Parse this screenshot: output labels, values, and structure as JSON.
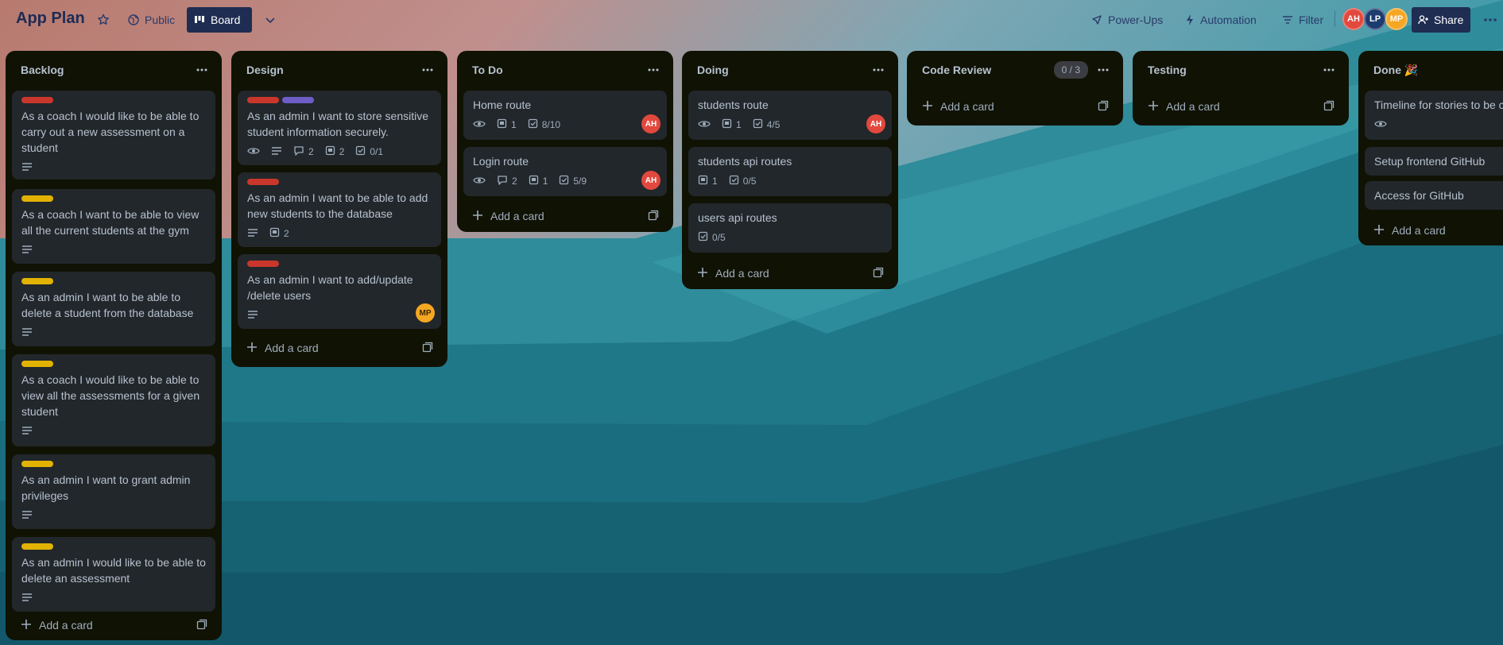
{
  "board": {
    "title": "App Plan",
    "visibility": "Public",
    "view": "Board"
  },
  "toolbar": {
    "power_ups": "Power-Ups",
    "automation": "Automation",
    "filter": "Filter",
    "share": "Share"
  },
  "members": [
    {
      "initials": "AH",
      "color": "#e2483d"
    },
    {
      "initials": "LP",
      "color": "#1d3b6e"
    },
    {
      "initials": "MP",
      "color": "#f5a623"
    }
  ],
  "add_card_label": "Add a card",
  "colors": {
    "red": "#c9372c",
    "yellow": "#e2b203",
    "purple": "#6e5dc6",
    "list_bg": "#101204",
    "card_bg": "#22272b"
  },
  "lists": [
    {
      "title": "Backlog",
      "cards": [
        {
          "labels": [
            "red"
          ],
          "title": "As a coach I would like to be able to carry out a new assessment on a student",
          "badges": [
            {
              "icon": "description-icon",
              "text": ""
            }
          ]
        },
        {
          "labels": [
            "yellow"
          ],
          "title": "As a coach I want to be able to view all the current students at the gym",
          "badges": [
            {
              "icon": "description-icon",
              "text": ""
            }
          ]
        },
        {
          "labels": [
            "yellow"
          ],
          "title": "As an admin I want to be able to delete a student from the database",
          "badges": [
            {
              "icon": "description-icon",
              "text": ""
            }
          ]
        },
        {
          "labels": [
            "yellow"
          ],
          "title": "As a coach I would like to be able to view all the assessments for a given student",
          "badges": [
            {
              "icon": "description-icon",
              "text": ""
            }
          ]
        },
        {
          "labels": [
            "yellow"
          ],
          "title": "As an admin I want to grant admin privileges",
          "badges": [
            {
              "icon": "description-icon",
              "text": ""
            }
          ]
        },
        {
          "labels": [
            "yellow"
          ],
          "title": "As an admin I would like to be able to delete an assessment",
          "badges": [
            {
              "icon": "description-icon",
              "text": ""
            }
          ]
        }
      ]
    },
    {
      "title": "Design",
      "cards": [
        {
          "labels": [
            "red",
            "purple"
          ],
          "title": "As an admin I want to store sensitive student information securely.",
          "badges": [
            {
              "icon": "eye-icon",
              "text": ""
            },
            {
              "icon": "description-icon",
              "text": ""
            },
            {
              "icon": "comment-icon",
              "text": "2"
            },
            {
              "icon": "attachment-icon",
              "text": "2"
            },
            {
              "icon": "checklist-icon",
              "text": "0/1"
            }
          ]
        },
        {
          "labels": [
            "red"
          ],
          "title": "As an admin I want to be able to add new students to the database",
          "badges": [
            {
              "icon": "description-icon",
              "text": ""
            },
            {
              "icon": "attachment-icon",
              "text": "2"
            }
          ]
        },
        {
          "labels": [
            "red"
          ],
          "title": "As an admin I want to add/update /delete users",
          "badges": [
            {
              "icon": "description-icon",
              "text": ""
            }
          ],
          "member": "MP"
        }
      ]
    },
    {
      "title": "To Do",
      "cards": [
        {
          "labels": [],
          "title": "Home route",
          "badges": [
            {
              "icon": "eye-icon",
              "text": ""
            },
            {
              "icon": "attachment-icon",
              "text": "1"
            },
            {
              "icon": "checklist-icon",
              "text": "8/10"
            }
          ],
          "member": "AH"
        },
        {
          "labels": [],
          "title": "Login route",
          "badges": [
            {
              "icon": "eye-icon",
              "text": ""
            },
            {
              "icon": "comment-icon",
              "text": "2"
            },
            {
              "icon": "attachment-icon",
              "text": "1"
            },
            {
              "icon": "checklist-icon",
              "text": "5/9"
            }
          ],
          "member": "AH"
        }
      ]
    },
    {
      "title": "Doing",
      "cards": [
        {
          "labels": [],
          "title": "students route",
          "badges": [
            {
              "icon": "eye-icon",
              "text": ""
            },
            {
              "icon": "attachment-icon",
              "text": "1"
            },
            {
              "icon": "checklist-icon",
              "text": "4/5"
            }
          ],
          "member": "AH"
        },
        {
          "labels": [],
          "title": "students api routes",
          "badges": [
            {
              "icon": "attachment-icon",
              "text": "1"
            },
            {
              "icon": "checklist-icon",
              "text": "0/5"
            }
          ]
        },
        {
          "labels": [],
          "title": "users api routes",
          "badges": [
            {
              "icon": "checklist-icon",
              "text": "0/5"
            }
          ]
        }
      ]
    },
    {
      "title": "Code Review",
      "wip": "0 / 3",
      "cards": []
    },
    {
      "title": "Testing",
      "cards": []
    },
    {
      "title": "Done 🎉",
      "cards": [
        {
          "labels": [],
          "title": "Timeline for stories to be c",
          "badges": [
            {
              "icon": "eye-icon",
              "text": ""
            }
          ]
        },
        {
          "labels": [],
          "title": "Setup frontend GitHub",
          "badges": []
        },
        {
          "labels": [],
          "title": "Access for GitHub",
          "badges": []
        }
      ]
    }
  ]
}
